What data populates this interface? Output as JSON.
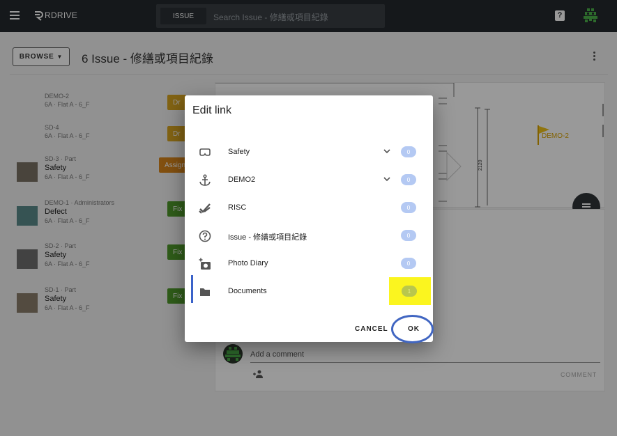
{
  "appbar": {
    "brand": "RDRIVE",
    "search_scope": "ISSUE",
    "search_placeholder": "Search Issue - 修繕或項目紀錄",
    "help_label": "?"
  },
  "header": {
    "browse_label": "BROWSE",
    "page_title": "6 Issue - 修繕或項目紀錄"
  },
  "issues": [
    {
      "meta": "DEMO-2",
      "title": "",
      "location": "6A · Flat A - 6_F",
      "tag": "Dr",
      "tag_color": "#d9a520",
      "has_thumb": false
    },
    {
      "meta": "SD-4",
      "title": "",
      "location": "6A · Flat A - 6_F",
      "tag": "Dr",
      "tag_color": "#d9a520",
      "has_thumb": false
    },
    {
      "meta": "SD-3 · Part",
      "title": "Safety",
      "location": "6A · Flat A - 6_F",
      "tag": "Assign",
      "tag_color": "#d9861c",
      "has_thumb": true
    },
    {
      "meta": "DEMO-1 · Administrators",
      "title": "Defect",
      "location": "6A · Flat A - 6_F",
      "tag": "Fix",
      "tag_color": "#4f9a2b",
      "has_thumb": true
    },
    {
      "meta": "SD-2 · Part",
      "title": "Safety",
      "location": "6A · Flat A - 6_F",
      "tag": "Fix",
      "tag_color": "#4f9a2b",
      "has_thumb": true
    },
    {
      "meta": "SD-1 · Part",
      "title": "Safety",
      "location": "6A · Flat A - 6_F",
      "tag": "Fix",
      "tag_color": "#4f9a2b",
      "has_thumb": true
    }
  ],
  "drawing": {
    "dimension_label": "2120",
    "flag_label": "DEMO-2"
  },
  "comment": {
    "placeholder": "Add a comment",
    "button_label": "COMMENT"
  },
  "dialog": {
    "title": "Edit link",
    "rows": [
      {
        "icon": "vr-goggles-icon",
        "label": "Safety",
        "expandable": true,
        "count": "0"
      },
      {
        "icon": "anchor-icon",
        "label": "DEMO2",
        "expandable": true,
        "count": "0"
      },
      {
        "icon": "double-check-icon",
        "label": "RISC",
        "expandable": false,
        "count": "0"
      },
      {
        "icon": "help-circle-icon",
        "label": "Issue - 修繕或項目紀錄",
        "expandable": false,
        "count": "0"
      },
      {
        "icon": "add-photo-icon",
        "label": "Photo Diary",
        "expandable": false,
        "count": "0"
      },
      {
        "icon": "folder-icon",
        "label": "Documents",
        "expandable": false,
        "count": "1"
      }
    ],
    "cancel_label": "CANCEL",
    "ok_label": "OK"
  },
  "colors": {
    "appbar": "#23282d",
    "count_badge": "#b4c9f3",
    "highlight": "#fbf51f",
    "ok_circle": "#4166c2"
  }
}
